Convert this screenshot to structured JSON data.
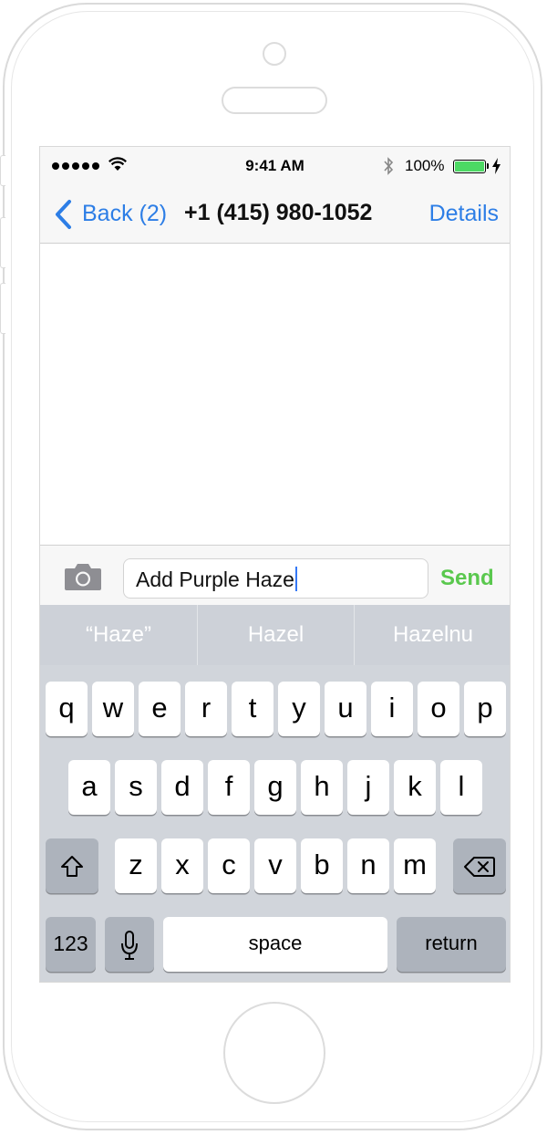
{
  "status": {
    "time": "9:41 AM",
    "battery_percent": "100%",
    "battery_level": 1.0
  },
  "nav": {
    "back_label": "Back (2)",
    "title": "+1 (415) 980-1052",
    "details_label": "Details"
  },
  "compose": {
    "input_value": "Add Purple Haze",
    "send_label": "Send"
  },
  "predictions": [
    "“Haze”",
    "Hazel",
    "Hazelnu"
  ],
  "keyboard": {
    "row1": [
      "q",
      "w",
      "e",
      "r",
      "t",
      "y",
      "u",
      "i",
      "o",
      "p"
    ],
    "row2": [
      "a",
      "s",
      "d",
      "f",
      "g",
      "h",
      "j",
      "k",
      "l"
    ],
    "row3": [
      "z",
      "x",
      "c",
      "v",
      "b",
      "n",
      "m"
    ],
    "numbers_label": "123",
    "space_label": "space",
    "return_label": "return"
  },
  "icons": [
    "signal-icon",
    "wifi-icon",
    "bluetooth-icon",
    "battery-icon",
    "charging-icon",
    "back-chevron-icon",
    "camera-icon",
    "shift-icon",
    "delete-icon",
    "microphone-icon"
  ],
  "colors": {
    "accent": "#2d7ee6",
    "send": "#5ac84e",
    "battery": "#4cd964",
    "keyboard_bg": "#d1d5db",
    "system_key": "#adb3bc"
  }
}
